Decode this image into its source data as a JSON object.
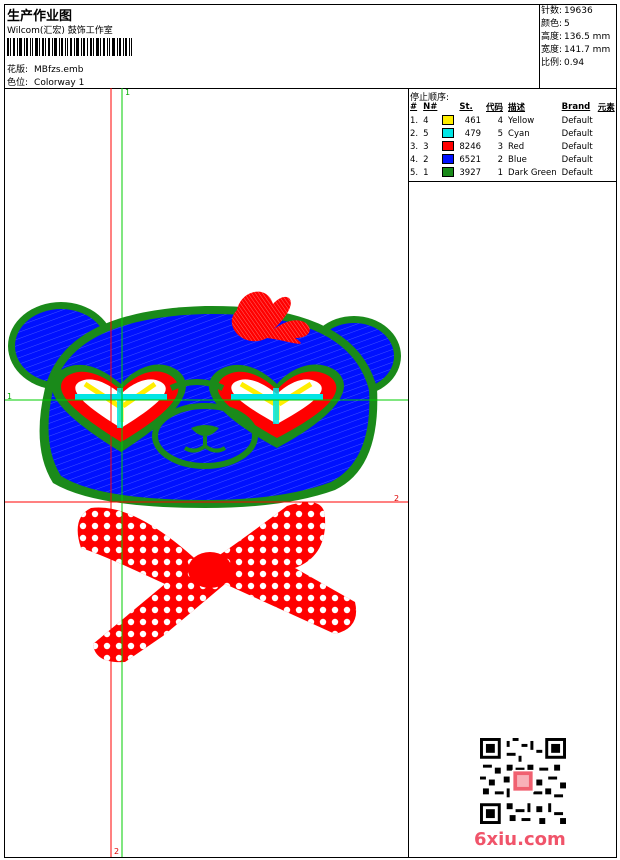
{
  "header": {
    "title": "生产作业图",
    "subtitle": "Wilcom(汇宏) 鼓饰工作室",
    "design_label": "花版:",
    "design_value": "MBfzs.emb",
    "colorway_label": "色位:",
    "colorway_value": "Colorway 1"
  },
  "stats": {
    "stitches_label": "针数:",
    "stitches_value": "19636",
    "colors_label": "颜色:",
    "colors_value": "5",
    "height_label": "高度:",
    "height_value": "136.5 mm",
    "width_label": "宽度:",
    "width_value": "141.7 mm",
    "scale_label": "比例:",
    "scale_value": "0.94"
  },
  "stop_sequence": {
    "title": "停止顺序:",
    "columns": [
      "#",
      "N#",
      "St.",
      "代码",
      "描述",
      "Brand",
      "元素"
    ],
    "rows": [
      {
        "idx": "1.",
        "n": "4",
        "color": "#ffee00",
        "st": "461",
        "code": "4",
        "desc": "Yellow",
        "brand": "Default"
      },
      {
        "idx": "2.",
        "n": "5",
        "color": "#00e5e5",
        "st": "479",
        "code": "5",
        "desc": "Cyan",
        "brand": "Default"
      },
      {
        "idx": "3.",
        "n": "3",
        "color": "#ff0000",
        "st": "8246",
        "code": "3",
        "desc": "Red",
        "brand": "Default"
      },
      {
        "idx": "4.",
        "n": "2",
        "color": "#0011ff",
        "st": "6521",
        "code": "2",
        "desc": "Blue",
        "brand": "Default"
      },
      {
        "idx": "5.",
        "n": "1",
        "color": "#1a8a1a",
        "st": "3927",
        "code": "1",
        "desc": "Dark Green",
        "brand": "Default"
      }
    ]
  },
  "axis_labels": {
    "green_v": "1",
    "green_h": "1",
    "red_h": "2",
    "red_v": "2"
  },
  "watermark": "6xiu.com",
  "colors": {
    "blue": "#0011ff",
    "green": "#1a8a1a",
    "red": "#ff0000",
    "yellow": "#ffee00",
    "cyan": "#00e5e5"
  }
}
